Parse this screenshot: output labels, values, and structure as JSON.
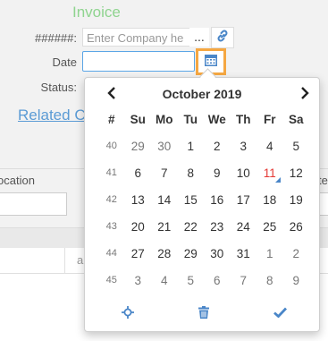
{
  "form": {
    "title": "Invoice",
    "company_label": "######:",
    "company_placeholder": "Enter Company he",
    "more_label": "...",
    "date_label": "Date",
    "status_label": "Status:",
    "related_link": "Related C"
  },
  "grid": {
    "location_header": "ocation",
    "right_header": "te",
    "cell_a": "a"
  },
  "calendar": {
    "month_title": "October 2019",
    "week_header": "#",
    "day_headers": [
      "Su",
      "Mo",
      "Tu",
      "We",
      "Th",
      "Fr",
      "Sa"
    ],
    "today": "11",
    "weeks": [
      {
        "wk": "40",
        "days": [
          "29",
          "30",
          "1",
          "2",
          "3",
          "4",
          "5"
        ],
        "muted": [
          0,
          1
        ]
      },
      {
        "wk": "41",
        "days": [
          "6",
          "7",
          "8",
          "9",
          "10",
          "11",
          "12"
        ],
        "muted": []
      },
      {
        "wk": "42",
        "days": [
          "13",
          "14",
          "15",
          "16",
          "17",
          "18",
          "19"
        ],
        "muted": []
      },
      {
        "wk": "43",
        "days": [
          "20",
          "21",
          "22",
          "23",
          "24",
          "25",
          "26"
        ],
        "muted": []
      },
      {
        "wk": "44",
        "days": [
          "27",
          "28",
          "29",
          "30",
          "31",
          "1",
          "2"
        ],
        "muted": [
          5,
          6
        ]
      },
      {
        "wk": "45",
        "days": [
          "3",
          "4",
          "5",
          "6",
          "7",
          "8",
          "9"
        ],
        "muted": [
          0,
          1,
          2,
          3,
          4,
          5,
          6
        ]
      }
    ]
  },
  "icons": {
    "prev": "chevron-left-icon",
    "next": "chevron-right-icon",
    "link": "link-icon",
    "calendar": "calendar-icon",
    "today": "crosshair-icon",
    "clear": "trash-icon",
    "close": "check-icon"
  },
  "colors": {
    "accent": "#4a86c8",
    "highlight": "#f5a742",
    "today": "#e53935",
    "title": "#8fd48f"
  }
}
